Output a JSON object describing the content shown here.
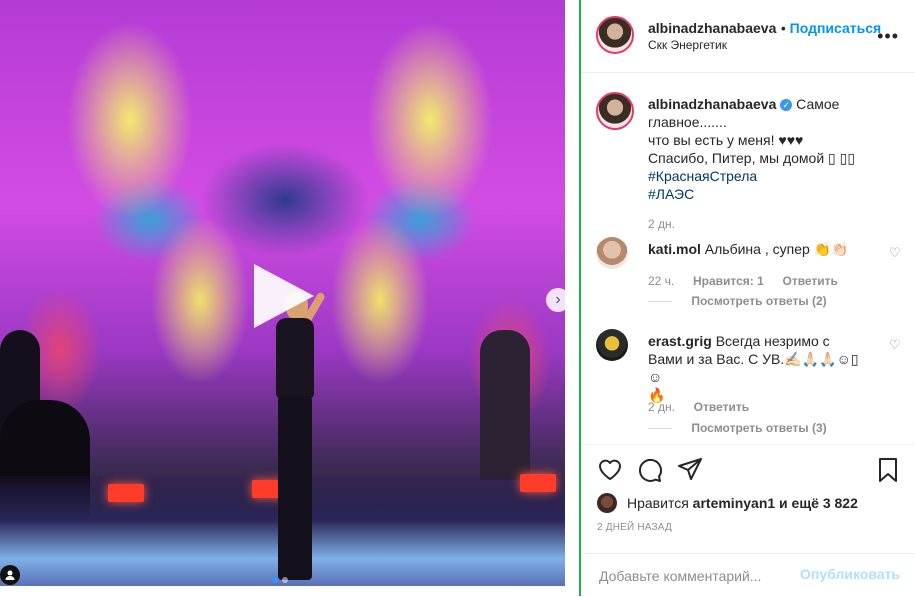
{
  "post": {
    "username": "albinadzhanabaeva",
    "follow_label": "Подписаться",
    "location": "Скк Энергетик",
    "more_label": "•••"
  },
  "caption": {
    "username": "albinadzhanabaeva",
    "line1": "Самое",
    "line2": "главное.......",
    "line3": "что вы есть у меня! ♥♥♥",
    "line4": "Спасибо, Питер, мы домой ▯ ▯▯",
    "hashtag1": "#КраснаяСтрела",
    "hashtag2": "#ЛАЭС",
    "time": "2 дн."
  },
  "comments": [
    {
      "username": "kati.mol",
      "text": "Альбина , супер 👏👏🏻",
      "time": "22 ч.",
      "likes": "Нравится: 1",
      "reply_label": "Ответить",
      "view_replies": "Посмотреть ответы (2)"
    },
    {
      "username": "erast.grig",
      "text_line1": "Всегда незримо с",
      "text_line2": "Вами и за Вас. С УВ.✍🏻🙏🏻🙏🏻☺▯☺",
      "text_line3": "🔥",
      "time": "2 дн.",
      "reply_label": "Ответить",
      "view_replies": "Посмотреть ответы (3)"
    }
  ],
  "likes": {
    "prefix": "Нравится",
    "user": "arteminyan1",
    "suffix": "и ещё 3 822"
  },
  "date": "2 ДНЕЙ НАЗАД",
  "add_comment": {
    "placeholder": "Добавьте комментарий...",
    "publish_label": "Опубликовать"
  },
  "carousel": {
    "total_slides": 2,
    "active_slide": 1
  },
  "colors": {
    "accent": "#0095f6",
    "verified": "#3897f0",
    "divider": "#22b04a"
  }
}
